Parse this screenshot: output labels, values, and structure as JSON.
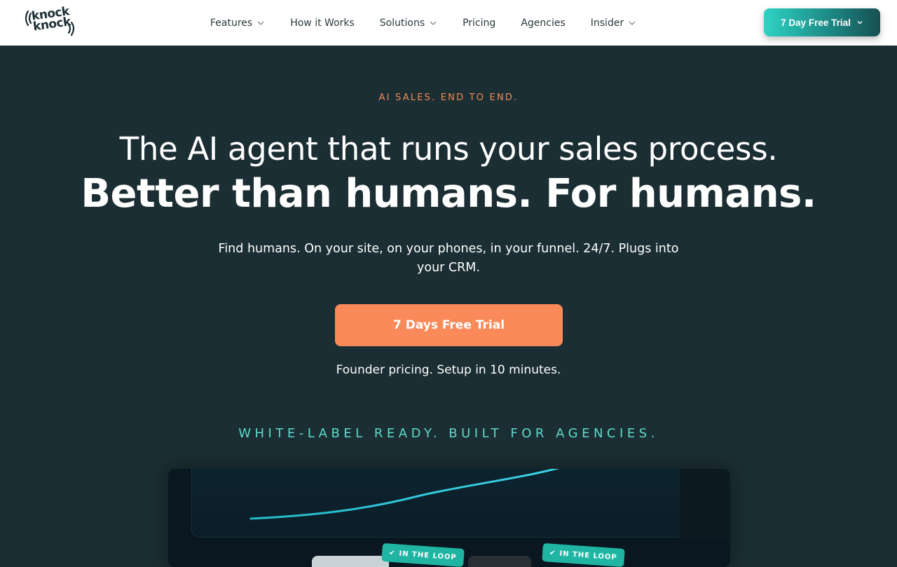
{
  "brand": {
    "logo_text": "knock knock"
  },
  "nav": {
    "items": [
      {
        "label": "Features",
        "has_dropdown": true
      },
      {
        "label": "How it Works",
        "has_dropdown": false
      },
      {
        "label": "Solutions",
        "has_dropdown": true
      },
      {
        "label": "Pricing",
        "has_dropdown": false
      },
      {
        "label": "Agencies",
        "has_dropdown": false
      },
      {
        "label": "Insider",
        "has_dropdown": true
      }
    ],
    "trial_button": "7 Day Free Trial"
  },
  "hero": {
    "eyebrow": "AI SALES. END TO END.",
    "headline_line1": "The AI agent that runs your sales process.",
    "headline_line2": "Better than humans. For humans.",
    "subtext": "Find humans. On your site, on your phones, in your funnel. 24/7. Plugs into your CRM.",
    "cta": "7 Days Free Trial",
    "cta_note": "Founder pricing. Setup in 10 minutes.",
    "agency_tagline": "WHITE-LABEL READY. BUILT FOR AGENCIES."
  },
  "preview": {
    "badges": [
      "IN THE LOOP",
      "IN THE LOOP"
    ]
  },
  "colors": {
    "background": "#1b2e33",
    "header": "#ffffff",
    "accent_orange": "#fb8a5a",
    "accent_teal": "#2fd3c4",
    "tagline_teal": "#5fd9cc"
  }
}
